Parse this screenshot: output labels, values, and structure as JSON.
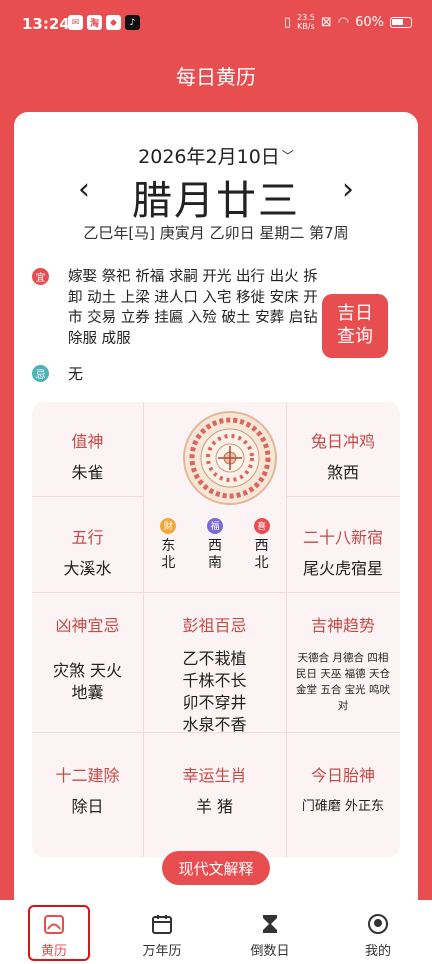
{
  "status_bar": {
    "time": "13:24",
    "net_speed_top": "23.5",
    "net_speed_bottom": "KB/s",
    "battery": "60%"
  },
  "header": {
    "title": "每日黄历"
  },
  "date": {
    "solar": "2026年2月10日",
    "lunar": "腊月廿三",
    "ganzhi": "乙巳年[马] 庚寅月 乙卯日 星期二 第7周",
    "prev": "‹",
    "next": "›"
  },
  "yi": {
    "badge": "宜",
    "text": "嫁娶 祭祀 祈福 求嗣 开光 出行 出火 拆卸 动土 上梁 进人口 入宅 移徙 安床 开市 交易 立券 挂匾 入殓 破土 安葬 启钻 除服 成服"
  },
  "ji": {
    "badge": "忌",
    "text": "无"
  },
  "lucky_button": {
    "line1": "吉日",
    "line2": "查询"
  },
  "grid": {
    "zhishen": {
      "title": "值神",
      "value": "朱雀"
    },
    "chong": {
      "title": "兔日冲鸡",
      "value": "煞西"
    },
    "wuxing": {
      "title": "五行",
      "value": "大溪水"
    },
    "xiu": {
      "title": "二十八新宿",
      "value": "尾火虎宿星"
    },
    "directions": [
      {
        "badge": "财",
        "dir": "东北",
        "color": "#f2a93b"
      },
      {
        "badge": "福",
        "dir": "西南",
        "color": "#7b6ad6"
      },
      {
        "badge": "喜",
        "dir": "西北",
        "color": "#e84d50"
      }
    ],
    "xiongshen": {
      "title": "凶神宜忌",
      "value": "灾煞 天火 地囊"
    },
    "pengzu": {
      "title": "彭祖百忌",
      "lines": [
        "乙不栽植",
        "千株不长",
        "卯不穿井",
        "水泉不香"
      ]
    },
    "jishen": {
      "title": "吉神趋势",
      "value": "天德合 月德合 四相 民日 天巫 福德 天仓 金堂 五合 宝光 鸣吠对"
    },
    "jianchu": {
      "title": "十二建除",
      "value": "除日"
    },
    "shengxiao": {
      "title": "幸运生肖",
      "value": "羊 猪"
    },
    "taishen": {
      "title": "今日胎神",
      "value": "门碓磨 外正东"
    }
  },
  "modern_button": "现代文解释",
  "bottom_nav": [
    {
      "label": "黄历",
      "icon": "almanac-icon",
      "active": true
    },
    {
      "label": "万年历",
      "icon": "calendar-icon",
      "active": false
    },
    {
      "label": "倒数日",
      "icon": "hourglass-icon",
      "active": false
    },
    {
      "label": "我的",
      "icon": "profile-icon",
      "active": false
    }
  ],
  "colors": {
    "brand": "#e84d50",
    "title_red": "#c84a47",
    "ji_teal": "#4fb3b6"
  }
}
